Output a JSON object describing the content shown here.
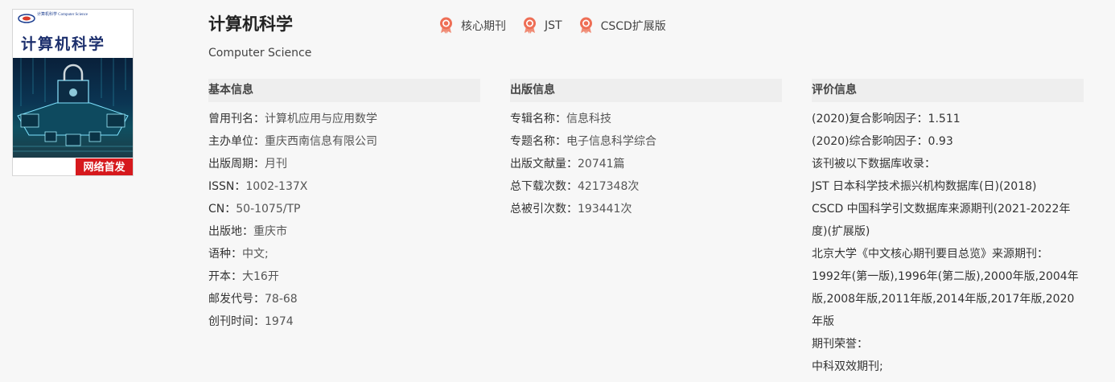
{
  "cover": {
    "logo_text": "计算机科学 Computer Science",
    "title": "计算机科学",
    "badge": "网络首发"
  },
  "header": {
    "title": "计算机科学",
    "subtitle": "Computer Science",
    "tags": [
      {
        "label": "核心期刊"
      },
      {
        "label": "JST"
      },
      {
        "label": "CSCD扩展版"
      }
    ]
  },
  "basic": {
    "heading": "基本信息",
    "rows": [
      {
        "k": "曾用刊名：",
        "v": "计算机应用与应用数学"
      },
      {
        "k": "主办单位：",
        "v": "重庆西南信息有限公司"
      },
      {
        "k": "出版周期：",
        "v": "月刊"
      },
      {
        "k": "ISSN：",
        "v": "1002-137X"
      },
      {
        "k": "CN：",
        "v": "50-1075/TP"
      },
      {
        "k": "出版地：",
        "v": "重庆市"
      },
      {
        "k": "语种：",
        "v": "中文;"
      },
      {
        "k": "开本：",
        "v": "大16开"
      },
      {
        "k": "邮发代号：",
        "v": "78-68"
      },
      {
        "k": "创刊时间：",
        "v": "1974"
      }
    ]
  },
  "publish": {
    "heading": "出版信息",
    "rows": [
      {
        "k": "专辑名称：",
        "v": "信息科技"
      },
      {
        "k": "专题名称：",
        "v": "电子信息科学综合"
      },
      {
        "k": "出版文献量：",
        "v": "20741篇"
      },
      {
        "k": "总下载次数：",
        "v": "4217348次"
      },
      {
        "k": "总被引次数：",
        "v": "193441次"
      }
    ]
  },
  "evaluation": {
    "heading": "评价信息",
    "lines": [
      "(2020)复合影响因子：1.511",
      "(2020)综合影响因子：0.93",
      "该刊被以下数据库收录：",
      "JST 日本科学技术振兴机构数据库(日)(2018)",
      "CSCD 中国科学引文数据库来源期刊(2021-2022年度)(扩展版)",
      "北京大学《中文核心期刊要目总览》来源期刊：",
      "1992年(第一版),1996年(第二版),2000年版,2004年版,2008年版,2011年版,2014年版,2017年版,2020年版",
      "期刊荣誉：",
      "中科双效期刊;"
    ]
  }
}
